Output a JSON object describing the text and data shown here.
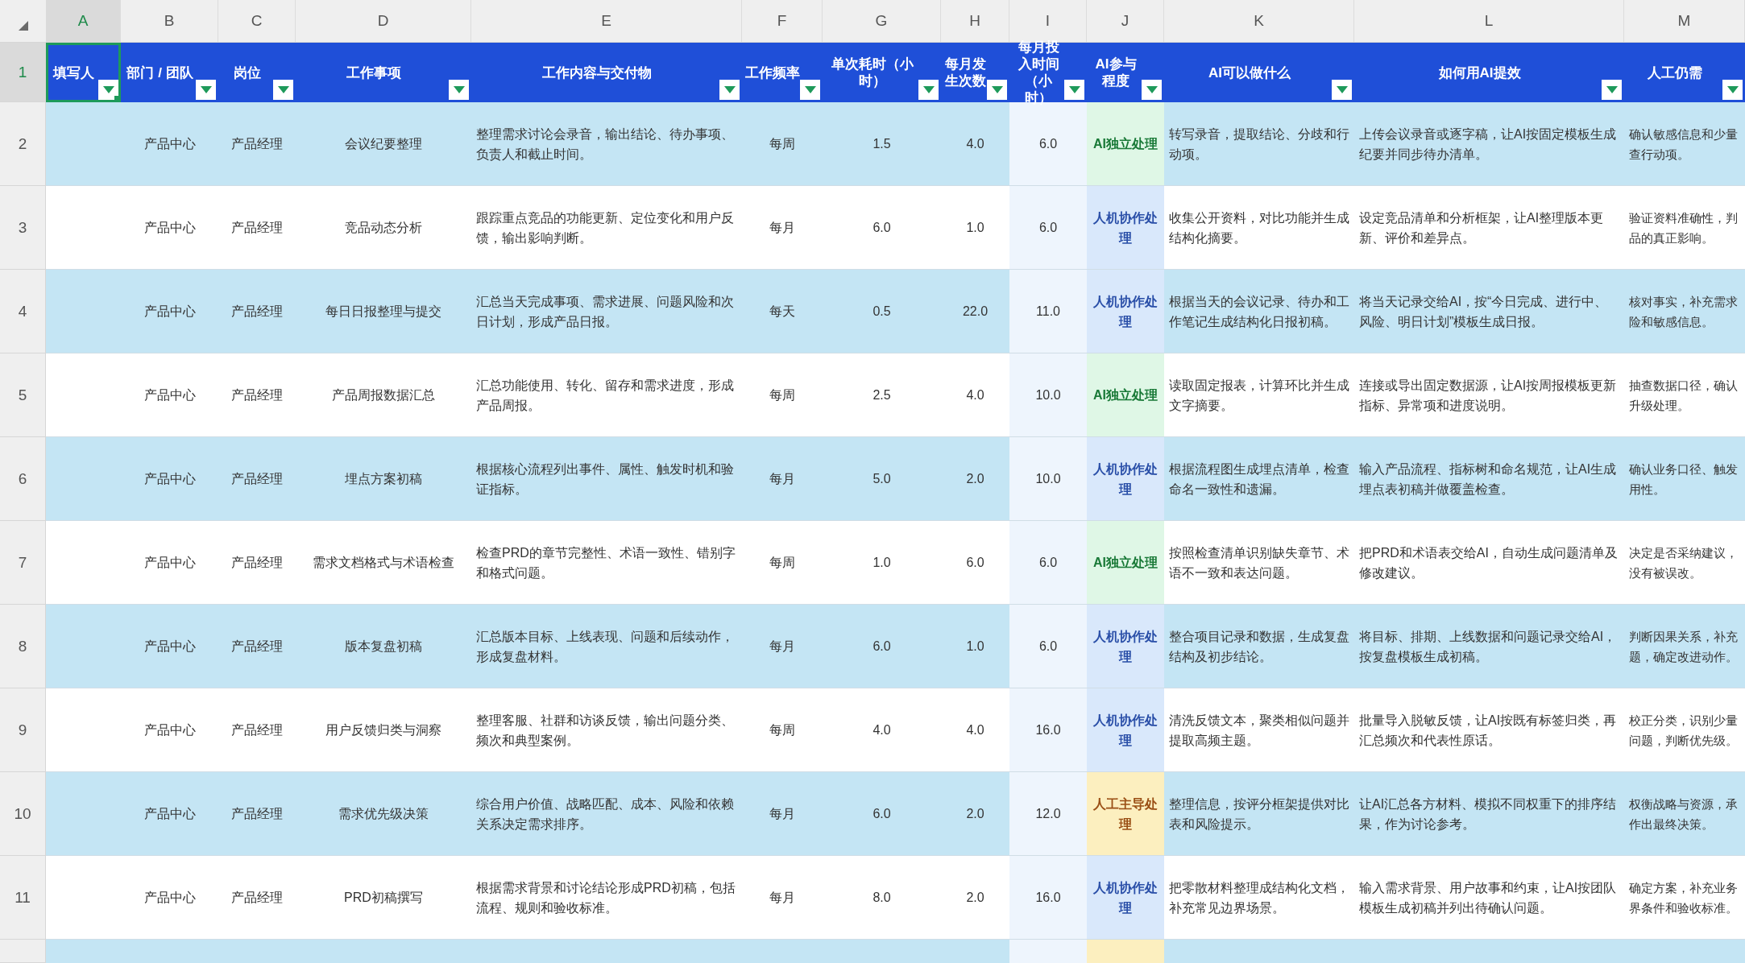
{
  "columns": [
    {
      "letter": "A",
      "header": "填写人",
      "selected": true
    },
    {
      "letter": "B",
      "header": "部门 / 团队",
      "selected": false
    },
    {
      "letter": "C",
      "header": "岗位",
      "selected": false
    },
    {
      "letter": "D",
      "header": "工作事项",
      "selected": false
    },
    {
      "letter": "E",
      "header": "工作内容与交付物",
      "selected": false
    },
    {
      "letter": "F",
      "header": "工作频率",
      "selected": false
    },
    {
      "letter": "G",
      "header": "单次耗时（小时）",
      "selected": false
    },
    {
      "letter": "H",
      "header": "每月发生次数",
      "selected": false
    },
    {
      "letter": "I",
      "header": "每月投入时间（小时）",
      "selected": false
    },
    {
      "letter": "J",
      "header": "AI参与程度",
      "selected": false
    },
    {
      "letter": "K",
      "header": "AI可以做什么",
      "selected": false
    },
    {
      "letter": "L",
      "header": "如何用AI提效",
      "selected": false
    },
    {
      "letter": "M",
      "header": "人工仍需",
      "selected": false
    }
  ],
  "header_row": {
    "number": "1",
    "selected": true
  },
  "rows": [
    {
      "number": "2",
      "dept": "产品中心",
      "role": "产品经理",
      "task": "会议纪要整理",
      "content": "整理需求讨论会录音，输出结论、待办事项、负责人和截止时间。",
      "frequency": "每周",
      "hours_each": "1.5",
      "times_month": "4.0",
      "hours_month": "6.0",
      "ai_level": {
        "text": "AI独立处理",
        "kind": "ai"
      },
      "ai_can": "转写录音，提取结论、分歧和行动项。",
      "how": "上传会议录音或逐字稿，让AI按固定模板生成纪要并同步待办清单。",
      "human": "确认敏感信息和少量查行动项。"
    },
    {
      "number": "3",
      "dept": "产品中心",
      "role": "产品经理",
      "task": "竞品动态分析",
      "content": "跟踪重点竞品的功能更新、定位变化和用户反馈，输出影响判断。",
      "frequency": "每月",
      "hours_each": "6.0",
      "times_month": "1.0",
      "hours_month": "6.0",
      "ai_level": {
        "text": "人机协作处理",
        "kind": "collab"
      },
      "ai_can": "收集公开资料，对比功能并生成结构化摘要。",
      "how": "设定竞品清单和分析框架，让AI整理版本更新、评价和差异点。",
      "human": "验证资料准确性，判品的真正影响。"
    },
    {
      "number": "4",
      "dept": "产品中心",
      "role": "产品经理",
      "task": "每日日报整理与提交",
      "content": "汇总当天完成事项、需求进展、问题风险和次日计划，形成产品日报。",
      "frequency": "每天",
      "hours_each": "0.5",
      "times_month": "22.0",
      "hours_month": "11.0",
      "ai_level": {
        "text": "人机协作处理",
        "kind": "collab"
      },
      "ai_can": "根据当天的会议记录、待办和工作笔记生成结构化日报初稿。",
      "how": "将当天记录交给AI，按“今日完成、进行中、风险、明日计划”模板生成日报。",
      "human": "核对事实，补充需求险和敏感信息。"
    },
    {
      "number": "5",
      "dept": "产品中心",
      "role": "产品经理",
      "task": "产品周报数据汇总",
      "content": "汇总功能使用、转化、留存和需求进度，形成产品周报。",
      "frequency": "每周",
      "hours_each": "2.5",
      "times_month": "4.0",
      "hours_month": "10.0",
      "ai_level": {
        "text": "AI独立处理",
        "kind": "ai"
      },
      "ai_can": "读取固定报表，计算环比并生成文字摘要。",
      "how": "连接或导出固定数据源，让AI按周报模板更新指标、异常项和进度说明。",
      "human": "抽查数据口径，确认升级处理。"
    },
    {
      "number": "6",
      "dept": "产品中心",
      "role": "产品经理",
      "task": "埋点方案初稿",
      "content": "根据核心流程列出事件、属性、触发时机和验证指标。",
      "frequency": "每月",
      "hours_each": "5.0",
      "times_month": "2.0",
      "hours_month": "10.0",
      "ai_level": {
        "text": "人机协作处理",
        "kind": "collab"
      },
      "ai_can": "根据流程图生成埋点清单，检查命名一致性和遗漏。",
      "how": "输入产品流程、指标树和命名规范，让AI生成埋点表初稿并做覆盖检查。",
      "human": "确认业务口径、触发用性。"
    },
    {
      "number": "7",
      "dept": "产品中心",
      "role": "产品经理",
      "task": "需求文档格式与术语检查",
      "content": "检查PRD的章节完整性、术语一致性、错别字和格式问题。",
      "frequency": "每周",
      "hours_each": "1.0",
      "times_month": "6.0",
      "hours_month": "6.0",
      "ai_level": {
        "text": "AI独立处理",
        "kind": "ai"
      },
      "ai_can": "按照检查清单识别缺失章节、术语不一致和表达问题。",
      "how": "把PRD和术语表交给AI，自动生成问题清单及修改建议。",
      "human": "决定是否采纳建议，没有被误改。"
    },
    {
      "number": "8",
      "dept": "产品中心",
      "role": "产品经理",
      "task": "版本复盘初稿",
      "content": "汇总版本目标、上线表现、问题和后续动作，形成复盘材料。",
      "frequency": "每月",
      "hours_each": "6.0",
      "times_month": "1.0",
      "hours_month": "6.0",
      "ai_level": {
        "text": "人机协作处理",
        "kind": "collab"
      },
      "ai_can": "整合项目记录和数据，生成复盘结构及初步结论。",
      "how": "将目标、排期、上线数据和问题记录交给AI，按复盘模板生成初稿。",
      "human": "判断因果关系，补充题，确定改进动作。"
    },
    {
      "number": "9",
      "dept": "产品中心",
      "role": "产品经理",
      "task": "用户反馈归类与洞察",
      "content": "整理客服、社群和访谈反馈，输出问题分类、频次和典型案例。",
      "frequency": "每周",
      "hours_each": "4.0",
      "times_month": "4.0",
      "hours_month": "16.0",
      "ai_level": {
        "text": "人机协作处理",
        "kind": "collab"
      },
      "ai_can": "清洗反馈文本，聚类相似问题并提取高频主题。",
      "how": "批量导入脱敏反馈，让AI按既有标签归类，再汇总频次和代表性原话。",
      "human": "校正分类，识别少量问题，判断优先级。"
    },
    {
      "number": "10",
      "dept": "产品中心",
      "role": "产品经理",
      "task": "需求优先级决策",
      "content": "综合用户价值、战略匹配、成本、风险和依赖关系决定需求排序。",
      "frequency": "每月",
      "hours_each": "6.0",
      "times_month": "2.0",
      "hours_month": "12.0",
      "ai_level": {
        "text": "人工主导处理",
        "kind": "human"
      },
      "ai_can": "整理信息，按评分框架提供对比表和风险提示。",
      "how": "让AI汇总各方材料、模拟不同权重下的排序结果，作为讨论参考。",
      "human": "权衡战略与资源，承作出最终决策。"
    },
    {
      "number": "11",
      "dept": "产品中心",
      "role": "产品经理",
      "task": "PRD初稿撰写",
      "content": "根据需求背景和讨论结论形成PRD初稿，包括流程、规则和验收标准。",
      "frequency": "每月",
      "hours_each": "8.0",
      "times_month": "2.0",
      "hours_month": "16.0",
      "ai_level": {
        "text": "人机协作处理",
        "kind": "collab"
      },
      "ai_can": "把零散材料整理成结构化文档，补充常见边界场景。",
      "how": "输入需求背景、用户故事和约束，让AI按团队模板生成初稿并列出待确认问题。",
      "human": "确定方案，补充业务界条件和验收标准。"
    }
  ],
  "partial_row": {
    "ai_level": {
      "kind": "human"
    }
  }
}
